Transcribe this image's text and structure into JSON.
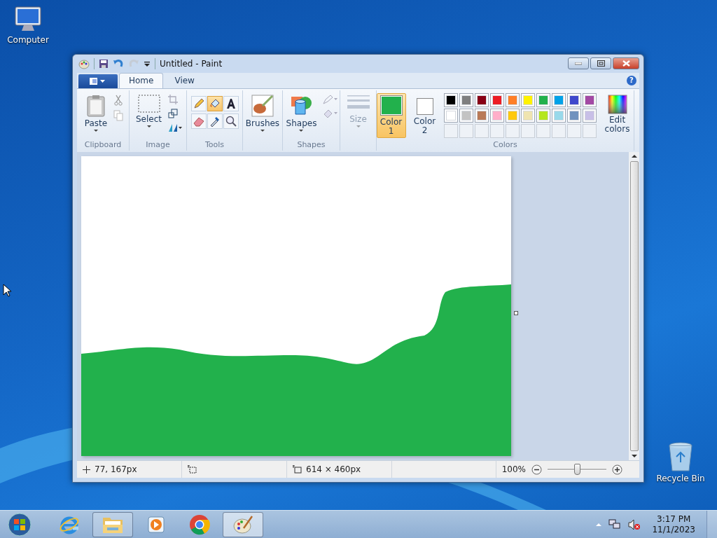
{
  "desktop_icons": [
    {
      "kind": "computer",
      "label": "Computer"
    },
    {
      "kind": "recycle",
      "label": "Recycle Bin"
    }
  ],
  "window": {
    "title": "Untitled - Paint"
  },
  "tabs": [
    {
      "label": "Home",
      "selected": true
    },
    {
      "label": "View",
      "selected": false
    }
  ],
  "ribbon": {
    "clipboard": {
      "paste": "Paste",
      "label": "Clipboard"
    },
    "image": {
      "select": "Select",
      "label": "Image"
    },
    "tools": {
      "label": "Tools",
      "items": [
        {
          "kind": "pencil",
          "selected": false
        },
        {
          "kind": "fill",
          "selected": true
        },
        {
          "kind": "text",
          "selected": false
        },
        {
          "kind": "eraser",
          "selected": false
        },
        {
          "kind": "picker",
          "selected": false
        },
        {
          "kind": "magnifier",
          "selected": false
        }
      ]
    },
    "brushes": "Brushes",
    "shapes": {
      "button": "Shapes",
      "label": "Shapes"
    },
    "size": {
      "label": "Size",
      "disabled": true
    },
    "colors": {
      "label": "Colors",
      "color1": {
        "label": "Color",
        "sub": "1",
        "color": "#22b14c",
        "selected": true
      },
      "color2": {
        "label": "Color",
        "sub": "2",
        "color": "#ffffff",
        "selected": false
      },
      "palette": [
        {
          "kind": "swatch",
          "color": "#000000"
        },
        {
          "kind": "swatch",
          "color": "#7f7f7f"
        },
        {
          "kind": "swatch",
          "color": "#880015"
        },
        {
          "kind": "swatch",
          "color": "#ed1c24"
        },
        {
          "kind": "swatch",
          "color": "#ff7f27"
        },
        {
          "kind": "swatch",
          "color": "#fff200"
        },
        {
          "kind": "swatch",
          "color": "#22b14c"
        },
        {
          "kind": "swatch",
          "color": "#00a2e8"
        },
        {
          "kind": "swatch",
          "color": "#3f48cc"
        },
        {
          "kind": "swatch",
          "color": "#a349a4"
        },
        {
          "kind": "swatch",
          "color": "#ffffff"
        },
        {
          "kind": "swatch",
          "color": "#c3c3c3"
        },
        {
          "kind": "swatch",
          "color": "#b97a57"
        },
        {
          "kind": "swatch",
          "color": "#ffaec9"
        },
        {
          "kind": "swatch",
          "color": "#ffc90e"
        },
        {
          "kind": "swatch",
          "color": "#efe4b0"
        },
        {
          "kind": "swatch",
          "color": "#b5e61d"
        },
        {
          "kind": "swatch",
          "color": "#99d9ea"
        },
        {
          "kind": "swatch",
          "color": "#7092be"
        },
        {
          "kind": "swatch",
          "color": "#c8bfe7"
        },
        {
          "kind": "empty"
        },
        {
          "kind": "empty"
        },
        {
          "kind": "empty"
        },
        {
          "kind": "empty"
        },
        {
          "kind": "empty"
        },
        {
          "kind": "empty"
        },
        {
          "kind": "empty"
        },
        {
          "kind": "empty"
        },
        {
          "kind": "empty"
        },
        {
          "kind": "empty"
        }
      ],
      "edit": "Edit colors"
    }
  },
  "status_bar": {
    "position": "77, 167px",
    "canvas_size": "614 × 460px",
    "zoom": "100%",
    "level": 0.5
  },
  "help": "?",
  "taskbar": {
    "items": [
      {
        "kind": "ie",
        "running": false,
        "selected": false
      },
      {
        "kind": "explorer",
        "running": true,
        "selected": false
      },
      {
        "kind": "media",
        "running": false,
        "selected": false
      },
      {
        "kind": "chrome",
        "running": false,
        "selected": false
      },
      {
        "kind": "paint",
        "running": true,
        "selected": true
      }
    ],
    "time": "3:17 PM",
    "date": "11/1/2023"
  }
}
